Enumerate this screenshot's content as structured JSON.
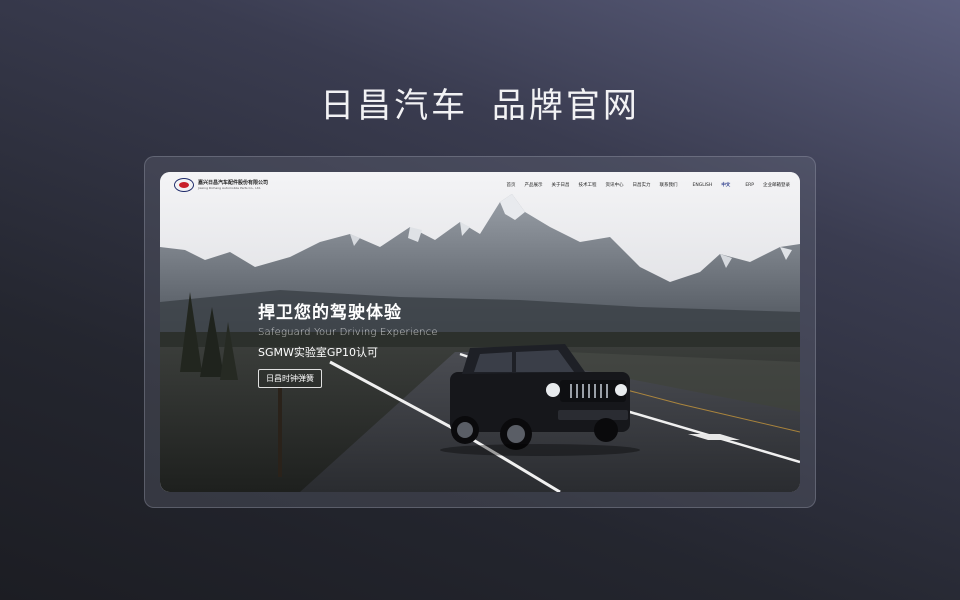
{
  "showcase": {
    "title": "日昌汽车  品牌官网"
  },
  "site": {
    "logo": {
      "name_cn": "嘉兴日昌汽车配件股份有限公司",
      "name_en": "Jiaxing Richang Automobile Parts Co., Ltd."
    },
    "nav": {
      "items": [
        {
          "label": "首页"
        },
        {
          "label": "产品展示"
        },
        {
          "label": "关于日昌"
        },
        {
          "label": "技术工程"
        },
        {
          "label": "资讯中心"
        },
        {
          "label": "日昌实力"
        },
        {
          "label": "联系我们"
        }
      ],
      "lang_en": "ENGLISH",
      "lang_cn": "中文",
      "erp": "ERP",
      "mail": "企业邮箱登录"
    },
    "hero": {
      "headline": "捍卫您的驾驶体验",
      "subheadline": "Safeguard Your Driving Experience",
      "certification": "SGMW实验室GP10认可",
      "button": "日昌时钟弹簧"
    }
  },
  "colors": {
    "accent": "#2a3a8a",
    "logo_red": "#c8202a",
    "background_top": "#5c5f7e",
    "background_bottom": "#1c1d23"
  }
}
